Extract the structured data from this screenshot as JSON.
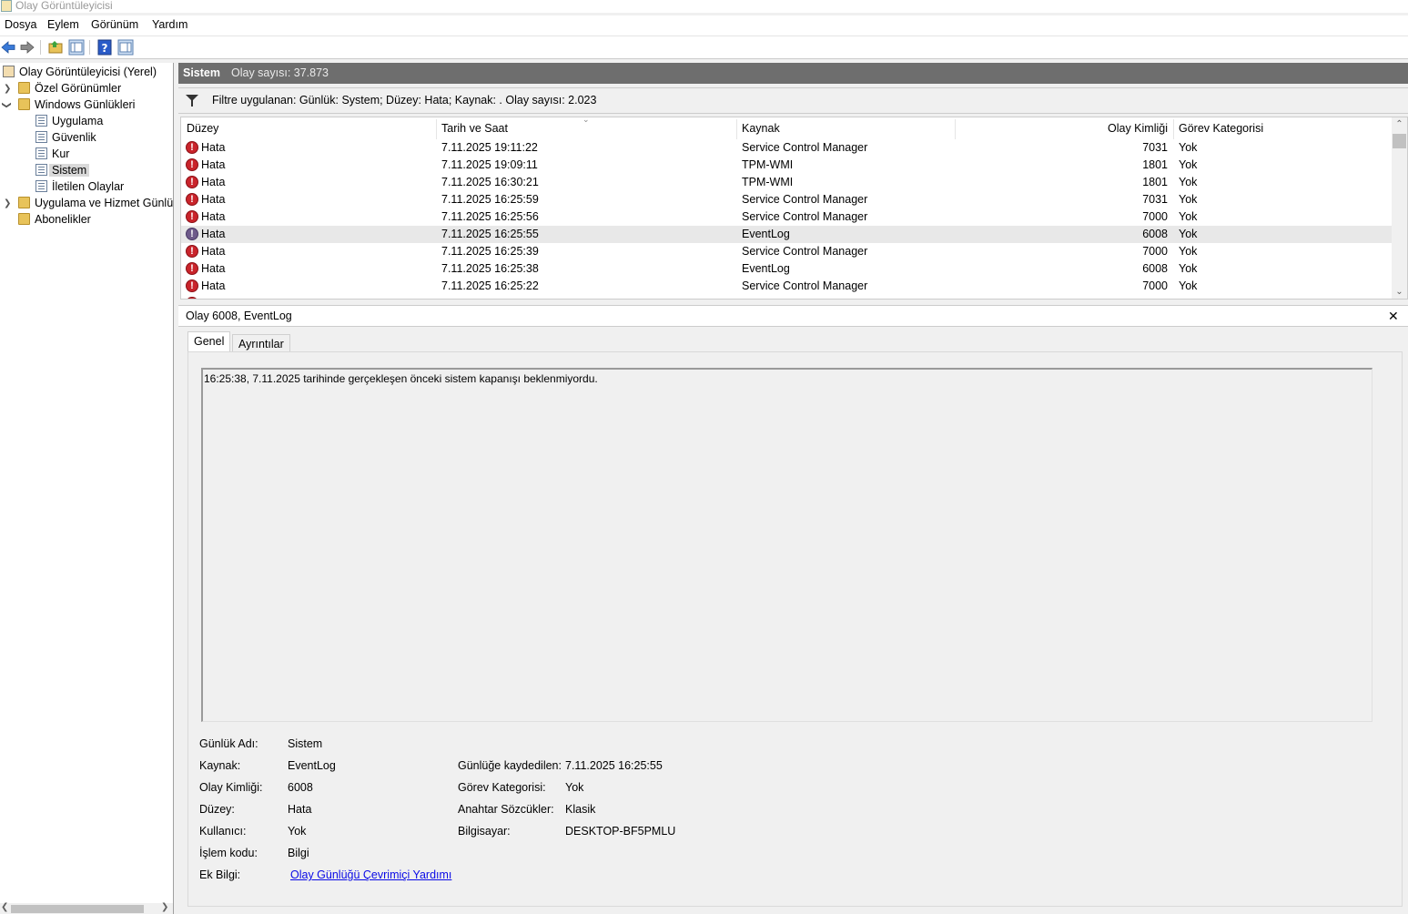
{
  "window": {
    "title": "Olay Görüntüleyicisi"
  },
  "menu": [
    "Dosya",
    "Eylem",
    "Görünüm",
    "Yardım"
  ],
  "tree": {
    "root": "Olay Görüntüleyicisi (Yerel)",
    "custom_views": "Özel Görünümler",
    "windows_logs": "Windows Günlükleri",
    "logs": [
      "Uygulama",
      "Güvenlik",
      "Kur",
      "Sistem",
      "İletilen Olaylar"
    ],
    "app_service_logs": "Uygulama ve Hizmet Günlük",
    "subscriptions": "Abonelikler"
  },
  "header": {
    "log_name": "Sistem",
    "count": "Olay sayısı: 37.873"
  },
  "filter": {
    "text": "Filtre uygulanan: Günlük: System; Düzey: Hata; Kaynak: . Olay sayısı: 2.023"
  },
  "table": {
    "columns": [
      "Düzey",
      "Tarih ve Saat",
      "Kaynak",
      "Olay Kimliği",
      "Görev Kategorisi"
    ],
    "rows": [
      {
        "level": "Hata",
        "date": "7.11.2025 19:11:22",
        "source": "Service Control Manager",
        "id": "7031",
        "category": "Yok"
      },
      {
        "level": "Hata",
        "date": "7.11.2025 19:09:11",
        "source": "TPM-WMI",
        "id": "1801",
        "category": "Yok"
      },
      {
        "level": "Hata",
        "date": "7.11.2025 16:30:21",
        "source": "TPM-WMI",
        "id": "1801",
        "category": "Yok"
      },
      {
        "level": "Hata",
        "date": "7.11.2025 16:25:59",
        "source": "Service Control Manager",
        "id": "7031",
        "category": "Yok"
      },
      {
        "level": "Hata",
        "date": "7.11.2025 16:25:56",
        "source": "Service Control Manager",
        "id": "7000",
        "category": "Yok"
      },
      {
        "level": "Hata",
        "date": "7.11.2025 16:25:55",
        "source": "EventLog",
        "id": "6008",
        "category": "Yok"
      },
      {
        "level": "Hata",
        "date": "7.11.2025 16:25:39",
        "source": "Service Control Manager",
        "id": "7000",
        "category": "Yok"
      },
      {
        "level": "Hata",
        "date": "7.11.2025 16:25:38",
        "source": "EventLog",
        "id": "6008",
        "category": "Yok"
      },
      {
        "level": "Hata",
        "date": "7.11.2025 16:25:22",
        "source": "Service Control Manager",
        "id": "7000",
        "category": "Yok"
      }
    ],
    "selected_index": 5
  },
  "event": {
    "title": "Olay 6008, EventLog",
    "tabs": [
      "Genel",
      "Ayrıntılar"
    ],
    "description": "16:25:38, 7.11.2025 tarihinde gerçekleşen önceki sistem kapanışı beklenmiyordu.",
    "fields_left": [
      {
        "label": "Günlük Adı:",
        "value": "Sistem"
      },
      {
        "label": "Kaynak:",
        "value": "EventLog"
      },
      {
        "label": "Olay Kimliği:",
        "value": "6008"
      },
      {
        "label": "Düzey:",
        "value": "Hata"
      },
      {
        "label": "Kullanıcı:",
        "value": "Yok"
      },
      {
        "label": "İşlem kodu:",
        "value": "Bilgi"
      },
      {
        "label": "Ek Bilgi:",
        "value": "Olay Günlüğü Çevrimiçi Yardımı"
      }
    ],
    "fields_right": [
      {
        "label": "Günlüğe kaydedilen:",
        "value": "7.11.2025 16:25:55"
      },
      {
        "label": "Görev Kategorisi:",
        "value": "Yok"
      },
      {
        "label": "Anahtar Sözcükler:",
        "value": "Klasik"
      },
      {
        "label": "Bilgisayar:",
        "value": "DESKTOP-BF5PMLU"
      }
    ]
  },
  "icons": {
    "back": "back-arrow-icon",
    "forward": "forward-arrow-icon",
    "error": "error-icon",
    "filter": "funnel-icon",
    "close": "close-icon"
  },
  "colors": {
    "error_red": "#c9242b",
    "header_gray": "#6e6e6e",
    "link": "#0a0ae6"
  }
}
